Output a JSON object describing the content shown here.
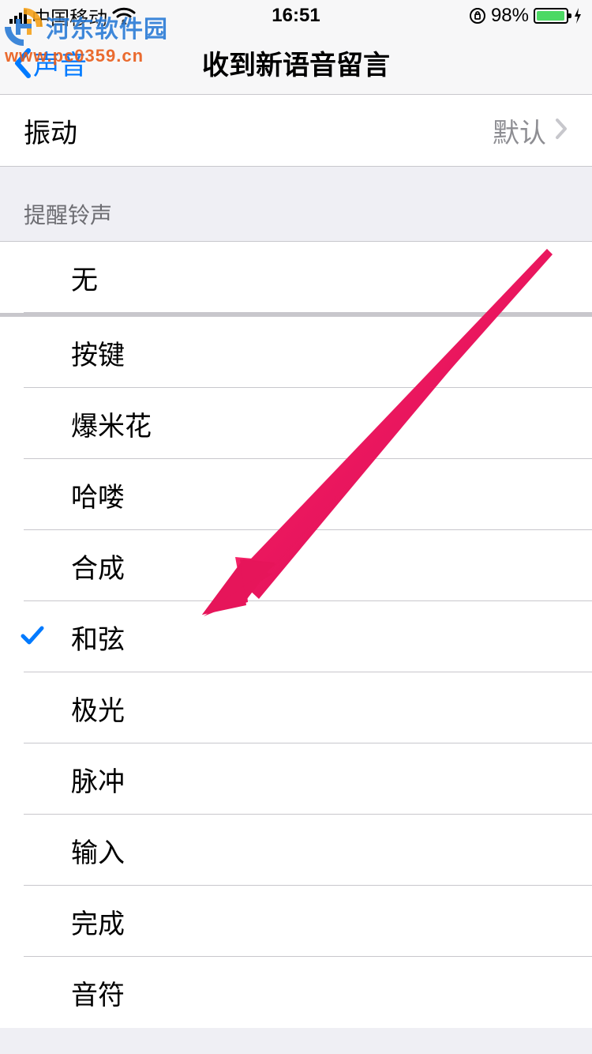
{
  "status": {
    "carrier": "中国移动",
    "time": "16:51",
    "lock_icon": "lock-rotation",
    "battery_pct": "98%"
  },
  "nav": {
    "back_label": "声音",
    "title": "收到新语音留言"
  },
  "vibration_row": {
    "label": "振动",
    "value": "默认"
  },
  "section_header": "提醒铃声",
  "tones": [
    {
      "label": "无",
      "selected": false
    },
    {
      "label": "按键",
      "selected": false
    },
    {
      "label": "爆米花",
      "selected": false
    },
    {
      "label": "哈喽",
      "selected": false
    },
    {
      "label": "合成",
      "selected": false
    },
    {
      "label": "和弦",
      "selected": true
    },
    {
      "label": "极光",
      "selected": false
    },
    {
      "label": "脉冲",
      "selected": false
    },
    {
      "label": "输入",
      "selected": false
    },
    {
      "label": "完成",
      "selected": false
    },
    {
      "label": "音符",
      "selected": false
    }
  ],
  "watermark": {
    "brand": "河东软件园",
    "url": "www.pc0359.cn"
  },
  "annotation": {
    "arrow_color": "#e6155a"
  }
}
